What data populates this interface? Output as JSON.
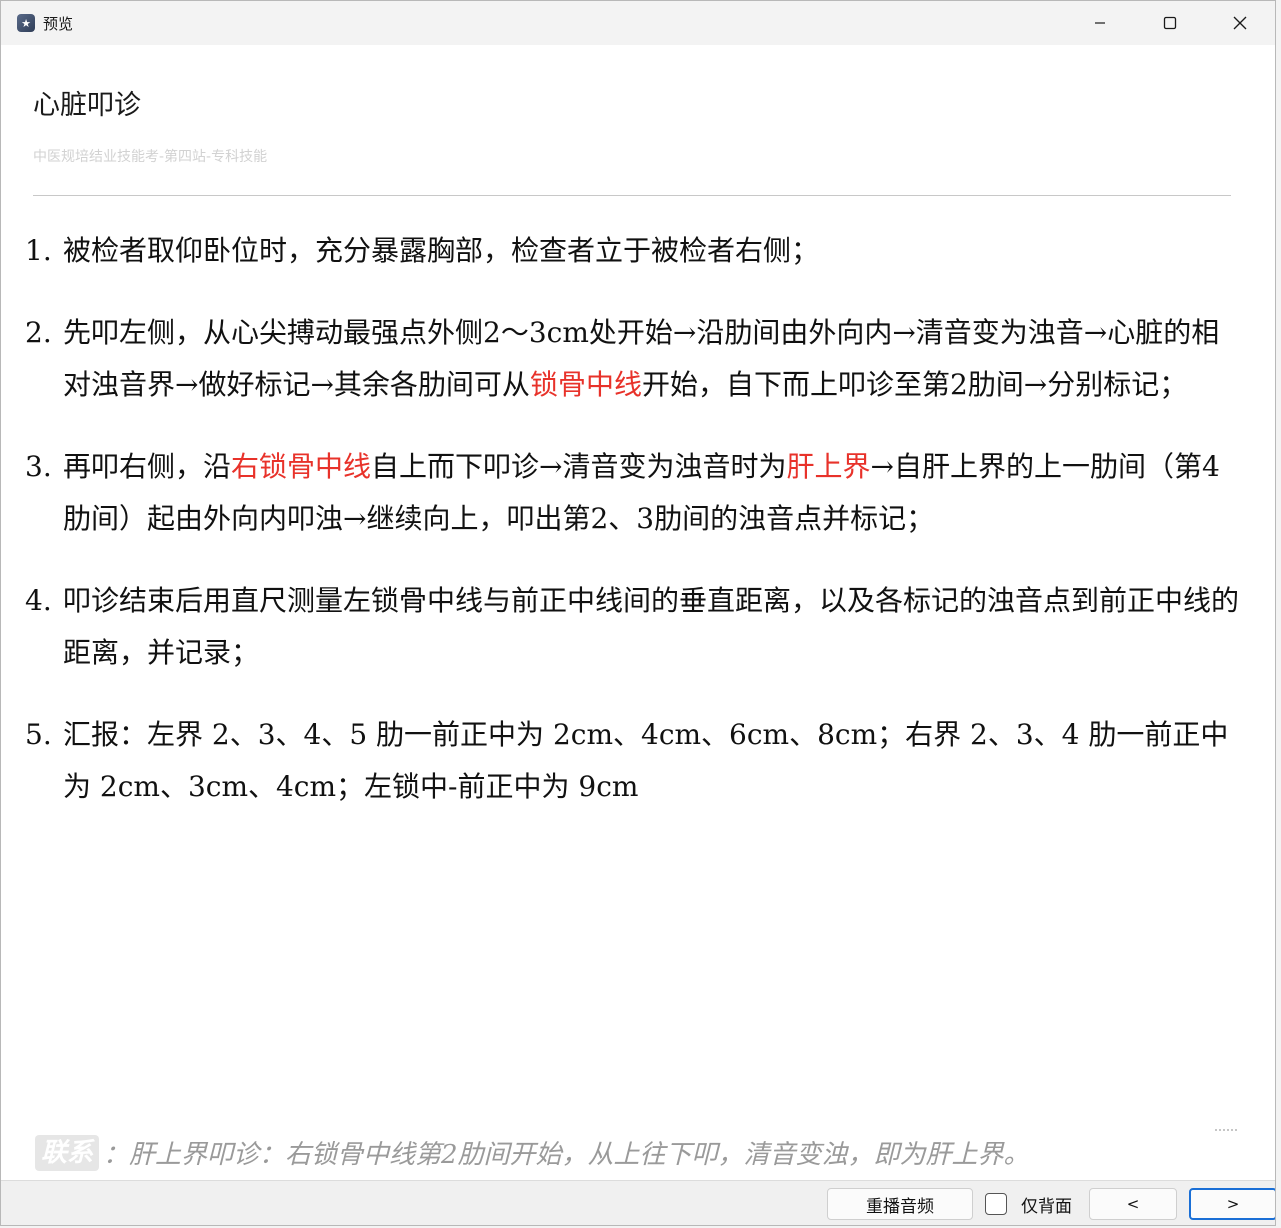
{
  "window": {
    "title": "预览",
    "controls": {
      "minimize": "—",
      "maximize": "☐",
      "close": "✕"
    }
  },
  "page": {
    "title": "心脏叩诊",
    "subtitle": "中医规培结业技能考-第四站-专科技能"
  },
  "steps": [
    {
      "num": "1.",
      "parts": [
        {
          "text": "被检者取仰卧位时，充分暴露胸部，检查者立于被检者右侧；"
        }
      ]
    },
    {
      "num": "2.",
      "parts": [
        {
          "text": "先叩左侧，从心尖搏动最强点外侧2～3cm处开始→沿肋间由外向内→清音变为浊音→心脏的相对浊音界→做好标记→其余各肋间可从"
        },
        {
          "text": "锁骨中线",
          "highlight": true
        },
        {
          "text": "开始，自下而上叩诊至第2肋间→分别标记；"
        }
      ]
    },
    {
      "num": "3.",
      "parts": [
        {
          "text": "再叩右侧，沿"
        },
        {
          "text": "右锁骨中线",
          "highlight": true
        },
        {
          "text": "自上而下叩诊→清音变为浊音时为"
        },
        {
          "text": "肝上界",
          "highlight": true
        },
        {
          "text": "→自肝上界的上一肋间（第4肋间）起由外向内叩浊→继续向上，叩出第2、3肋间的浊音点并标记；"
        }
      ]
    },
    {
      "num": "4.",
      "parts": [
        {
          "text": "叩诊结束后用直尺测量左锁骨中线与前正中线间的垂直距离，以及各标记的浊音点到前正中线的距离，并记录；"
        }
      ]
    },
    {
      "num": "5.",
      "parts": [
        {
          "text": "汇报：左界 2、3、4、5 肋一前正中为 2cm、4cm、6cm、8cm；右界 2、3、4 肋一前正中为 2cm、3cm、4cm；左锁中-前正中为 9cm"
        }
      ]
    }
  ],
  "footnote": {
    "tag": "联系",
    "text": "：肝上界叩诊：右锁骨中线第2肋间开始，从上往下叩，清音变浊，即为肝上界。"
  },
  "toolbar": {
    "replay_label": "重播音频",
    "back_only_label": "仅背面",
    "back_only_checked": false,
    "prev_label": "<",
    "next_label": ">"
  },
  "colors": {
    "highlight": "#e8322a",
    "accent": "#1a6fd6"
  }
}
